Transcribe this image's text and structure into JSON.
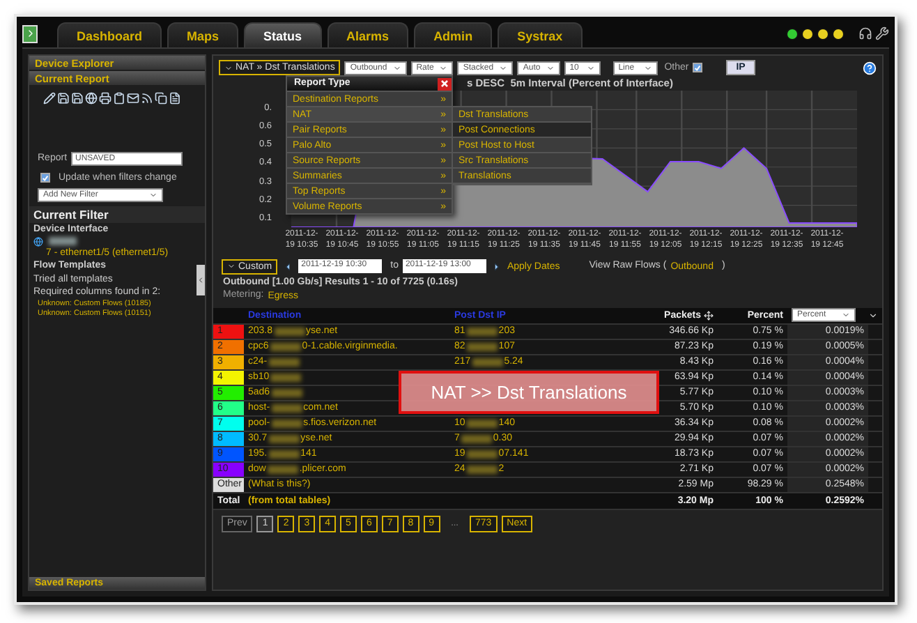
{
  "tabs": [
    {
      "label": "Dashboard",
      "selected": false
    },
    {
      "label": "Maps",
      "selected": false
    },
    {
      "label": "Status",
      "selected": true
    },
    {
      "label": "Alarms",
      "selected": false
    },
    {
      "label": "Admin",
      "selected": false
    },
    {
      "label": "Systrax",
      "selected": false
    }
  ],
  "status_lights": [
    {
      "color": "#33cc33"
    },
    {
      "color": "#e8d020"
    },
    {
      "color": "#e8d020"
    },
    {
      "color": "#e8d020"
    }
  ],
  "sidebar": {
    "headers": [
      "Device Explorer",
      "Current Report"
    ],
    "report_label": "Report",
    "report_value": "UNSAVED",
    "update_checkbox": {
      "label": "Update when filters change",
      "checked": true
    },
    "filter_select": "Add New Filter",
    "filter_title": "Current Filter",
    "device_heading": "Device Interface",
    "interface": "7 - ethernet1/5 (ethernet1/5)",
    "templates_heading": "Flow Templates",
    "template_lines": [
      "Tried all templates",
      "Required columns found in 2:"
    ],
    "template_links": [
      "Unknown: Custom Flows (10185)",
      "Unknown: Custom Flows (10151)"
    ],
    "footer": "Saved Reports"
  },
  "toolbar": {
    "report_button": "NAT » Dst Translations",
    "selects": [
      "Outbound",
      "Rate",
      "Stacked",
      "Auto",
      "10",
      "Line"
    ],
    "other": {
      "label": "Other",
      "checked": true
    },
    "ip_button": "IP"
  },
  "menu": {
    "title": "Report Type",
    "items": [
      {
        "label": "Destination Reports",
        "expanded": false
      },
      {
        "label": "NAT",
        "expanded": true
      },
      {
        "label": "Pair Reports",
        "expanded": false
      },
      {
        "label": "Palo Alto",
        "expanded": false
      },
      {
        "label": "Source Reports",
        "expanded": false
      },
      {
        "label": "Summaries",
        "expanded": false
      },
      {
        "label": "Top Reports",
        "expanded": false
      },
      {
        "label": "Volume Reports",
        "expanded": false
      }
    ],
    "arrow": "»",
    "submenu": [
      {
        "label": "Dst Translations",
        "selected": false
      },
      {
        "label": "Post Connections",
        "selected": true
      },
      {
        "label": "Post Host to Host",
        "selected": false
      },
      {
        "label": "Src Translations",
        "selected": false
      },
      {
        "label": "Translations",
        "selected": false
      }
    ]
  },
  "chart": {
    "title": "s DESC  5m Interval (Percent of Interface)",
    "y_labels": [
      "0.",
      "0.6",
      "0.5",
      "0.4",
      "0.3",
      "0.2",
      "0.1"
    ],
    "x_labels": [
      {
        "date": "2011-12-",
        "time": "19 10:35"
      },
      {
        "date": "2011-12-",
        "time": "19 10:45"
      },
      {
        "date": "2011-12-",
        "time": "19 10:55"
      },
      {
        "date": "2011-12-",
        "time": "19 11:05"
      },
      {
        "date": "2011-12-",
        "time": "19 11:15"
      },
      {
        "date": "2011-12-",
        "time": "19 11:25"
      },
      {
        "date": "2011-12-",
        "time": "19 11:35"
      },
      {
        "date": "2011-12-",
        "time": "19 11:45"
      },
      {
        "date": "2011-12-",
        "time": "19 11:55"
      },
      {
        "date": "2011-12-",
        "time": "19 12:05"
      },
      {
        "date": "2011-12-",
        "time": "19 12:15"
      },
      {
        "date": "2011-12-",
        "time": "19 12:25"
      },
      {
        "date": "2011-12-",
        "time": "19 12:35"
      },
      {
        "date": "2011-12-",
        "time": "19 12:45"
      }
    ]
  },
  "dates": {
    "range_button": "Custom",
    "from": "2011-12-19 10:30",
    "to_label": "to",
    "to": "2011-12-19 13:00",
    "apply": "Apply Dates",
    "raw_label": "View Raw Flows (",
    "raw_link": "Outbound",
    "raw_end": ")"
  },
  "summary": "Outbound [1.00 Gb/s] Results 1 - 10 of 7725 (0.16s)",
  "metering_label": "Metering:",
  "metering_value": "Egress",
  "table": {
    "columns": [
      "Destination",
      "Post Dst IP",
      "Packets",
      "Percent"
    ],
    "percent_select": "Percent",
    "rows": [
      {
        "rank": "1",
        "color": "#ee1111",
        "dest": [
          "203.8",
          "yse.net"
        ],
        "ip": [
          "81",
          "203"
        ],
        "packets": "346.66 Kp",
        "percent": "0.75 %",
        "share": "0.0019%"
      },
      {
        "rank": "2",
        "color": "#f07000",
        "dest": [
          "cpc6",
          "0-1.cable.virginmedia."
        ],
        "ip": [
          "82",
          "107"
        ],
        "packets": "87.23 Kp",
        "percent": "0.19 %",
        "share": "0.0005%"
      },
      {
        "rank": "3",
        "color": "#f0b000",
        "dest": [
          "c24-"
        ],
        "blurred_tail": true,
        "ip": [
          "217",
          "5.24"
        ],
        "packets": "8.43 Kp",
        "percent": "0.16 %",
        "share": "0.0004%"
      },
      {
        "rank": "4",
        "color": "#f4f400",
        "dest": [
          "sb10"
        ],
        "blurred_tail": true,
        "packets": "63.94 Kp",
        "percent": "0.14 %",
        "share": "0.0004%"
      },
      {
        "rank": "5",
        "color": "#22ee00",
        "dest": [
          "5ad6"
        ],
        "blurred_tail": true,
        "packets": "5.77 Kp",
        "percent": "0.10 %",
        "share": "0.0003%"
      },
      {
        "rank": "6",
        "color": "#22ff88",
        "dest": [
          "host-",
          "com.net"
        ],
        "packets": "5.70 Kp",
        "percent": "0.10 %",
        "share": "0.0003%"
      },
      {
        "rank": "7",
        "color": "#00ffee",
        "dest": [
          "pool-",
          "s.fios.verizon.net"
        ],
        "ip": [
          "10",
          "140"
        ],
        "packets": "36.34 Kp",
        "percent": "0.08 %",
        "share": "0.0002%"
      },
      {
        "rank": "8",
        "color": "#00bbff",
        "dest": [
          "30.7",
          "yse.net"
        ],
        "ip": [
          "7",
          "0.30"
        ],
        "packets": "29.94 Kp",
        "percent": "0.07 %",
        "share": "0.0002%"
      },
      {
        "rank": "9",
        "color": "#0055ff",
        "dest": [
          "195.",
          "141"
        ],
        "ip": [
          "19",
          "07.141"
        ],
        "packets": "18.73 Kp",
        "percent": "0.07 %",
        "share": "0.0002%"
      },
      {
        "rank": "10",
        "color": "#8800ff",
        "dest": [
          "dow",
          ".plicer.com"
        ],
        "ip": [
          "24",
          "2"
        ],
        "packets": "2.71 Kp",
        "percent": "0.07 %",
        "share": "0.0002%"
      },
      {
        "rank": "Other",
        "color": "#dddddd",
        "dest": [
          "(What is this?)"
        ],
        "packets": "2.59 Mp",
        "percent": "98.29 %",
        "share": "0.2548%"
      }
    ],
    "total": {
      "label": "Total",
      "note": "(from total tables)",
      "packets": "3.20 Mp",
      "percent": "100 %",
      "share": "0.2592%"
    }
  },
  "pagination": [
    {
      "label": "Prev",
      "kind": "button",
      "disabled": true,
      "selected": false
    },
    {
      "label": "1",
      "kind": "button",
      "disabled": false,
      "selected": true
    },
    {
      "label": "2",
      "kind": "button",
      "disabled": false,
      "selected": false
    },
    {
      "label": "3",
      "kind": "button",
      "disabled": false,
      "selected": false
    },
    {
      "label": "4",
      "kind": "button",
      "disabled": false,
      "selected": false
    },
    {
      "label": "5",
      "kind": "button",
      "disabled": false,
      "selected": false
    },
    {
      "label": "6",
      "kind": "button",
      "disabled": false,
      "selected": false
    },
    {
      "label": "7",
      "kind": "button",
      "disabled": false,
      "selected": false
    },
    {
      "label": "8",
      "kind": "button",
      "disabled": false,
      "selected": false
    },
    {
      "label": "9",
      "kind": "button",
      "disabled": false,
      "selected": false
    },
    {
      "label": "...",
      "kind": "gap"
    },
    {
      "label": "773",
      "kind": "button",
      "disabled": false,
      "selected": false
    },
    {
      "label": "Next",
      "kind": "button",
      "disabled": false,
      "selected": false
    }
  ],
  "callout": "NAT >> Dst Translations"
}
